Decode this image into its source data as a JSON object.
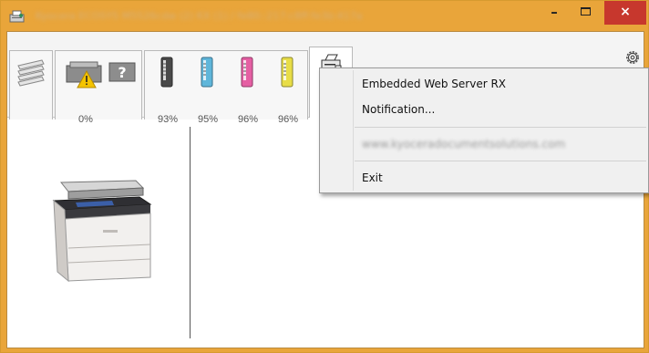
{
  "window": {
    "title": "Kyocera ECOSYS M5526cdw (2) KX (1) / fe80::217:c8ff:fe3b:417a",
    "minimize_label": "–",
    "close_label": "×"
  },
  "toolbar": {
    "tabs": [
      {
        "name": "jobs",
        "icon": "paper-stack-icon"
      },
      {
        "name": "status",
        "icon": "warning-printer-icon",
        "value": "0%"
      },
      {
        "name": "toner",
        "icon": "toner-icons"
      },
      {
        "name": "printer",
        "icon": "printer-menu-icon"
      }
    ],
    "paper_level": "0%",
    "toner": [
      {
        "color": "black",
        "level": "93%",
        "hex": "#4a4a4a"
      },
      {
        "color": "cyan",
        "level": "95%",
        "hex": "#5fb6da"
      },
      {
        "color": "magenta",
        "level": "96%",
        "hex": "#e55fa3"
      },
      {
        "color": "yellow",
        "level": "96%",
        "hex": "#e8dd47"
      }
    ],
    "settings_icon": "gear-icon"
  },
  "context_menu": {
    "items": [
      {
        "label": "Embedded Web Server RX"
      },
      {
        "label": "Notification..."
      },
      {
        "label": "www.kyoceradocumentsolutions.com"
      },
      {
        "label": "Exit"
      }
    ]
  },
  "colors": {
    "titlebar": "#e9a53a",
    "close": "#c7372d"
  }
}
